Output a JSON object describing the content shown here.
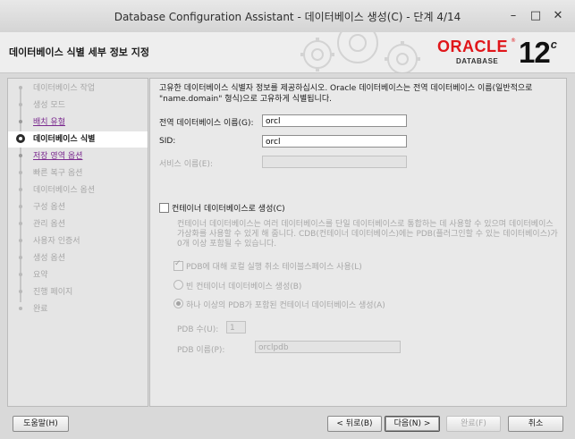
{
  "window": {
    "title": "Database Configuration Assistant - 데이터베이스 생성(C) - 단계 4/14",
    "minimize_glyph": "–",
    "maximize_glyph": "□",
    "close_glyph": "✕"
  },
  "header": {
    "page_title": "데이터베이스 식별 세부 정보 지정",
    "logo_oracle": "ORACLE",
    "logo_database": "DATABASE",
    "version": "12",
    "version_suffix": "c",
    "logo_registered": "®"
  },
  "steps": [
    {
      "label": "데이터베이스 작업",
      "state": "todo"
    },
    {
      "label": "생성 모드",
      "state": "todo"
    },
    {
      "label": "배치 유형",
      "state": "done"
    },
    {
      "label": "데이터베이스 식별",
      "state": "current"
    },
    {
      "label": "저장 영역 옵션",
      "state": "done"
    },
    {
      "label": "빠른 복구 옵션",
      "state": "todo"
    },
    {
      "label": "데이터베이스 옵션",
      "state": "todo"
    },
    {
      "label": "구성 옵션",
      "state": "todo"
    },
    {
      "label": "관리 옵션",
      "state": "todo"
    },
    {
      "label": "사용자 인증서",
      "state": "todo"
    },
    {
      "label": "생성 옵션",
      "state": "todo"
    },
    {
      "label": "요약",
      "state": "todo"
    },
    {
      "label": "진행 페이지",
      "state": "todo"
    },
    {
      "label": "완료",
      "state": "todo"
    }
  ],
  "main": {
    "description": "고유한 데이터베이스 식별자 정보를 제공하십시오. Oracle 데이터베이스는 전역 데이터베이스 이름(일반적으로 \"name.domain\" 형식)으로 고유하게 식별됩니다.",
    "global_db_name_label": "전역 데이터베이스 이름(G):",
    "global_db_name_value": "orcl",
    "sid_label": "SID:",
    "sid_value": "orcl",
    "service_name_label": "서비스 이름(E):",
    "service_name_value": "",
    "container_checkbox_label": "컨테이너 데이터베이스로 생성(C)",
    "container_checked": false,
    "cdb_description": "컨테이너 데이터베이스는 여러 데이터베이스를 단일 데이터베이스로 통합하는 데 사용할 수 있으며 데이터베이스 가상화를 사용할 수 있게 해 줍니다. CDB(컨테이너 데이터베이스)에는 PDB(플러그인할 수 있는 데이터베이스)가 0개 이상 포함될 수 있습니다.",
    "pdb_undo_label": "PDB에 대해 로컬 실행 취소 테이블스페이스 사용(L)",
    "pdb_undo_checked": true,
    "empty_cdb_label": "빈 컨테이너 데이터베이스 생성(B)",
    "with_pdb_label": "하나 이상의 PDB가 포함된 컨테이너 데이터베이스 생성(A)",
    "pdb_count_label": "PDB 수(U):",
    "pdb_count_value": "1",
    "pdb_name_label": "PDB 이름(P):",
    "pdb_name_value": "orclpdb"
  },
  "footer": {
    "help_label": "도움말(H)",
    "back_label": "< 뒤로(B)",
    "next_label": "다음(N) >",
    "finish_label": "완료(F)",
    "cancel_label": "취소"
  }
}
